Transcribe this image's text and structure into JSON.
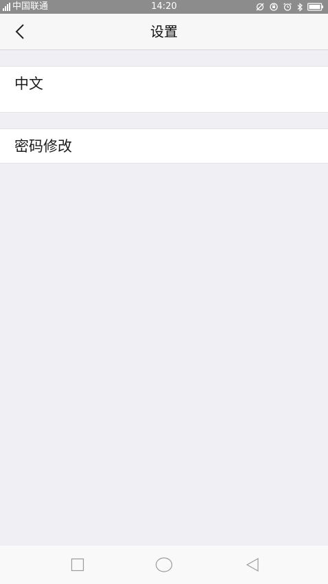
{
  "status_bar": {
    "carrier": "中国联通",
    "time": "14:20"
  },
  "nav": {
    "title": "设置"
  },
  "settings": {
    "items": [
      {
        "label": "中文"
      },
      {
        "label": "密码修改"
      }
    ]
  },
  "colors": {
    "status_bar": "#8c8c8c",
    "background": "#efeff4",
    "nav_bar": "#f7f7f7",
    "row": "#ffffff"
  },
  "icons": {
    "back": "chevron-left-icon",
    "recent": "square-icon",
    "home": "circle-icon",
    "system_back": "triangle-left-icon"
  }
}
